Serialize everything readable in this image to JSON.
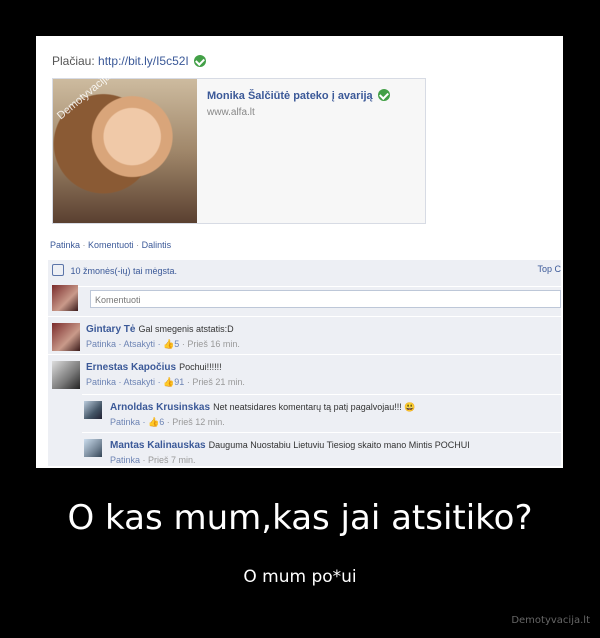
{
  "post": {
    "source_label": "Plačiau:",
    "source_link": "http://bit.ly/I5c52I",
    "preview": {
      "title": "Monika Šalčiūtė pateko į avariją",
      "domain": "www.alfa.lt",
      "watermark": "Demotyvacija.lt"
    },
    "actions": [
      "Patinka",
      "Komentuoti",
      "Dalintis"
    ],
    "likes_text": "10 žmonės(-ių) tai mėgsta.",
    "top_link": "Top C",
    "comment_placeholder": "Komentuoti"
  },
  "comments": [
    {
      "name": "Gintary Tė",
      "text": "Gal smegenis atstatis:D",
      "like": "Patinka",
      "reply": "Atsakyti",
      "likes": "5",
      "time": "Prieš 16 min."
    },
    {
      "name": "Ernestas Kapočius",
      "text": "Pochui!!!!!!",
      "like": "Patinka",
      "reply": "Atsakyti",
      "likes": "91",
      "time": "Prieš 21 min."
    }
  ],
  "replies": [
    {
      "name": "Arnoldas Krusinskas",
      "text": "Net neatsidares komentarų tą patį pagalvojau!!! 😃",
      "like": "Patinka",
      "likes": "6",
      "time": "Prieš 12 min."
    },
    {
      "name": "Mantas Kalinauskas",
      "text": "Dauguma Nuostabiu Lietuviu Tiesiog skaito mano Mintis POCHUI",
      "like": "Patinka",
      "time": "Prieš 7 min."
    }
  ],
  "poster": {
    "caption": "O kas mum,kas jai atsitiko?",
    "subcaption": "O mum po*ui",
    "site": "Demotyvacija.lt"
  }
}
